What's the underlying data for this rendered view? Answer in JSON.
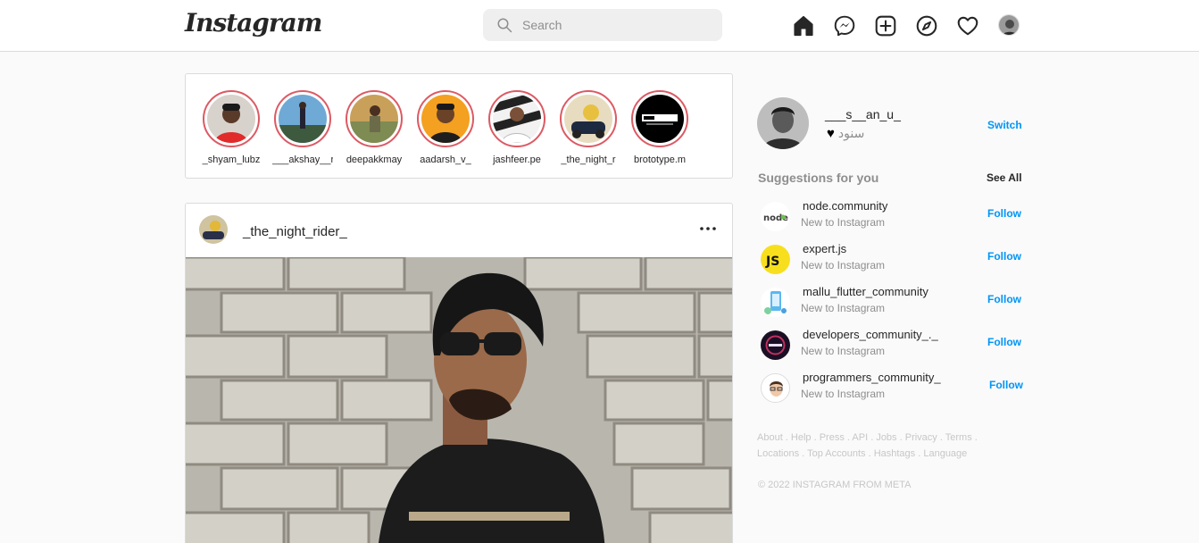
{
  "app": {
    "logo_text": "Instagram"
  },
  "search": {
    "placeholder": "Search",
    "value": ""
  },
  "nav_icons": [
    "home-icon",
    "messenger-icon",
    "new-post-icon",
    "explore-icon",
    "activity-heart-icon",
    "profile-avatar"
  ],
  "stories": [
    {
      "username": "_shyam_lubz"
    },
    {
      "username": "___akshay__r"
    },
    {
      "username": "deepakkmay"
    },
    {
      "username": "aadarsh_v_"
    },
    {
      "username": "jashfeer.pe"
    },
    {
      "username": "_the_night_r"
    },
    {
      "username": "brototype.m"
    }
  ],
  "story_ring_color": "#dc5a64",
  "post": {
    "username": "_the_night_rider_",
    "more_icon": "more-options-icon"
  },
  "profile": {
    "username": "___s__an_u_",
    "name": "سنود",
    "name_icon": "black-heart-icon",
    "switch_label": "Switch"
  },
  "suggestions_header": {
    "title": "Suggestions for you",
    "see_all": "See All"
  },
  "suggestions": [
    {
      "username": "node.community",
      "subtitle": "New to Instagram",
      "action": "Follow"
    },
    {
      "username": "expert.js",
      "subtitle": "New to Instagram",
      "action": "Follow"
    },
    {
      "username": "mallu_flutter_community",
      "subtitle": "New to Instagram",
      "action": "Follow"
    },
    {
      "username": "developers_community_._",
      "subtitle": "New to Instagram",
      "action": "Follow"
    },
    {
      "username": "programmers_community_",
      "subtitle": "New to Instagram",
      "action": "Follow"
    }
  ],
  "footer": {
    "links": [
      "About",
      "Help",
      "Press",
      "API",
      "Jobs",
      "Privacy",
      "Terms",
      "Locations",
      "Top Accounts",
      "Hashtags",
      "Language"
    ],
    "copyright": "© 2022 INSTAGRAM FROM META"
  },
  "colors": {
    "link_blue": "#0095f6",
    "text": "#262626",
    "muted": "#8e8e8e",
    "background": "#fafafa",
    "border": "#dbdbdb"
  }
}
